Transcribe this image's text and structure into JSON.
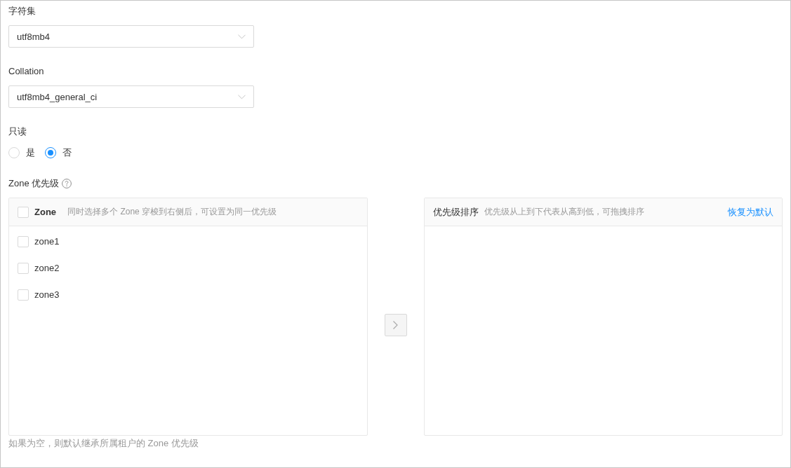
{
  "fields": [
    {
      "kind": "select",
      "label": "字符集",
      "value": "utf8mb4"
    },
    {
      "kind": "select",
      "label": "Collation",
      "value": "utf8mb4_general_ci"
    },
    {
      "kind": "radio",
      "label": "只读",
      "options": [
        {
          "label": "是",
          "selected": false
        },
        {
          "label": "否",
          "selected": true
        }
      ]
    }
  ],
  "zone_priority": {
    "label": "Zone 优先级",
    "source": {
      "title": "Zone",
      "hint": "同时选择多个 Zone 穿梭到右侧后，可设置为同一优先级",
      "checked": false,
      "items": [
        {
          "label": "zone1",
          "checked": false
        },
        {
          "label": "zone2",
          "checked": false
        },
        {
          "label": "zone3",
          "checked": false
        }
      ]
    },
    "transfer_button": {
      "disabled": true
    },
    "target": {
      "title": "优先级排序",
      "hint": "优先级从上到下代表从高到低，可拖拽排序",
      "reset_link": "恢复为默认"
    },
    "help_text": "如果为空，则默认继承所属租户的 Zone 优先级"
  }
}
